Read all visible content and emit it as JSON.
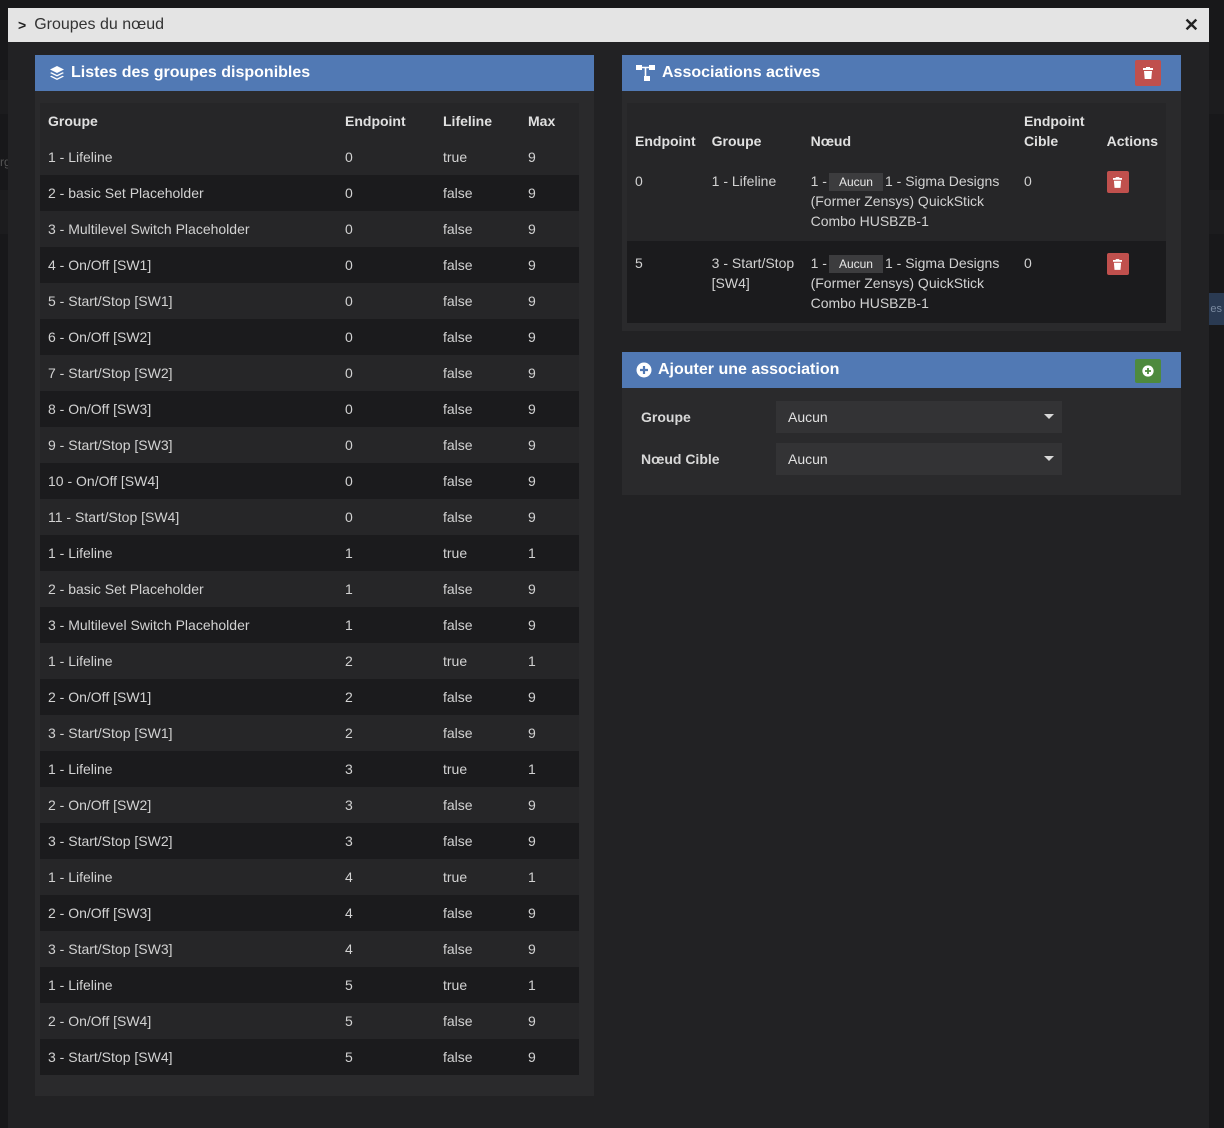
{
  "modal": {
    "title": "Groupes du nœud",
    "close_glyph": "✕"
  },
  "groups_panel": {
    "title": "Listes des groupes disponibles",
    "columns": [
      "Groupe",
      "Endpoint",
      "Lifeline",
      "Max"
    ],
    "rows": [
      [
        "1 - Lifeline",
        "0",
        "true",
        "9"
      ],
      [
        "2 - basic Set Placeholder",
        "0",
        "false",
        "9"
      ],
      [
        "3 - Multilevel Switch Placeholder",
        "0",
        "false",
        "9"
      ],
      [
        "4 - On/Off [SW1]",
        "0",
        "false",
        "9"
      ],
      [
        "5 - Start/Stop [SW1]",
        "0",
        "false",
        "9"
      ],
      [
        "6 - On/Off [SW2]",
        "0",
        "false",
        "9"
      ],
      [
        "7 - Start/Stop [SW2]",
        "0",
        "false",
        "9"
      ],
      [
        "8 - On/Off [SW3]",
        "0",
        "false",
        "9"
      ],
      [
        "9 - Start/Stop [SW3]",
        "0",
        "false",
        "9"
      ],
      [
        "10 - On/Off [SW4]",
        "0",
        "false",
        "9"
      ],
      [
        "11 - Start/Stop [SW4]",
        "0",
        "false",
        "9"
      ],
      [
        "1 - Lifeline",
        "1",
        "true",
        "1"
      ],
      [
        "2 - basic Set Placeholder",
        "1",
        "false",
        "9"
      ],
      [
        "3 - Multilevel Switch Placeholder",
        "1",
        "false",
        "9"
      ],
      [
        "1 - Lifeline",
        "2",
        "true",
        "1"
      ],
      [
        "2 - On/Off [SW1]",
        "2",
        "false",
        "9"
      ],
      [
        "3 - Start/Stop [SW1]",
        "2",
        "false",
        "9"
      ],
      [
        "1 - Lifeline",
        "3",
        "true",
        "1"
      ],
      [
        "2 - On/Off [SW2]",
        "3",
        "false",
        "9"
      ],
      [
        "3 - Start/Stop [SW2]",
        "3",
        "false",
        "9"
      ],
      [
        "1 - Lifeline",
        "4",
        "true",
        "1"
      ],
      [
        "2 - On/Off [SW3]",
        "4",
        "false",
        "9"
      ],
      [
        "3 - Start/Stop [SW3]",
        "4",
        "false",
        "9"
      ],
      [
        "1 - Lifeline",
        "5",
        "true",
        "1"
      ],
      [
        "2 - On/Off [SW4]",
        "5",
        "false",
        "9"
      ],
      [
        "3 - Start/Stop [SW4]",
        "5",
        "false",
        "9"
      ]
    ]
  },
  "assoc_panel": {
    "title": "Associations actives",
    "columns": {
      "endpoint": "Endpoint",
      "groupe": "Groupe",
      "noeud": "Nœud",
      "endpoint_cible_1": "Endpoint",
      "endpoint_cible_2": "Cible",
      "actions": "Actions"
    },
    "rows": [
      {
        "endpoint": "0",
        "groupe": "1 - Lifeline",
        "node_prefix": "1 -",
        "badge": "Aucun",
        "node_name": "1 - Sigma Designs (Former Zensys) QuickStick Combo HUSBZB-1",
        "target": "0"
      },
      {
        "endpoint": "5",
        "groupe": "3 - Start/Stop [SW4]",
        "node_prefix": "1 -",
        "badge": "Aucun",
        "node_name": "1 - Sigma Designs (Former Zensys) QuickStick Combo HUSBZB-1",
        "target": "0"
      }
    ]
  },
  "add_panel": {
    "title": "Ajouter une association",
    "groupe_label": "Groupe",
    "groupe_value": "Aucun",
    "target_label": "Nœud Cible",
    "target_value": "Aucun"
  },
  "background": {
    "fragment_left": "rg",
    "fragment_right": "es"
  },
  "colors": {
    "panel_header": "#5179b4",
    "danger": "#c0504d",
    "success": "#4e8a3e"
  }
}
